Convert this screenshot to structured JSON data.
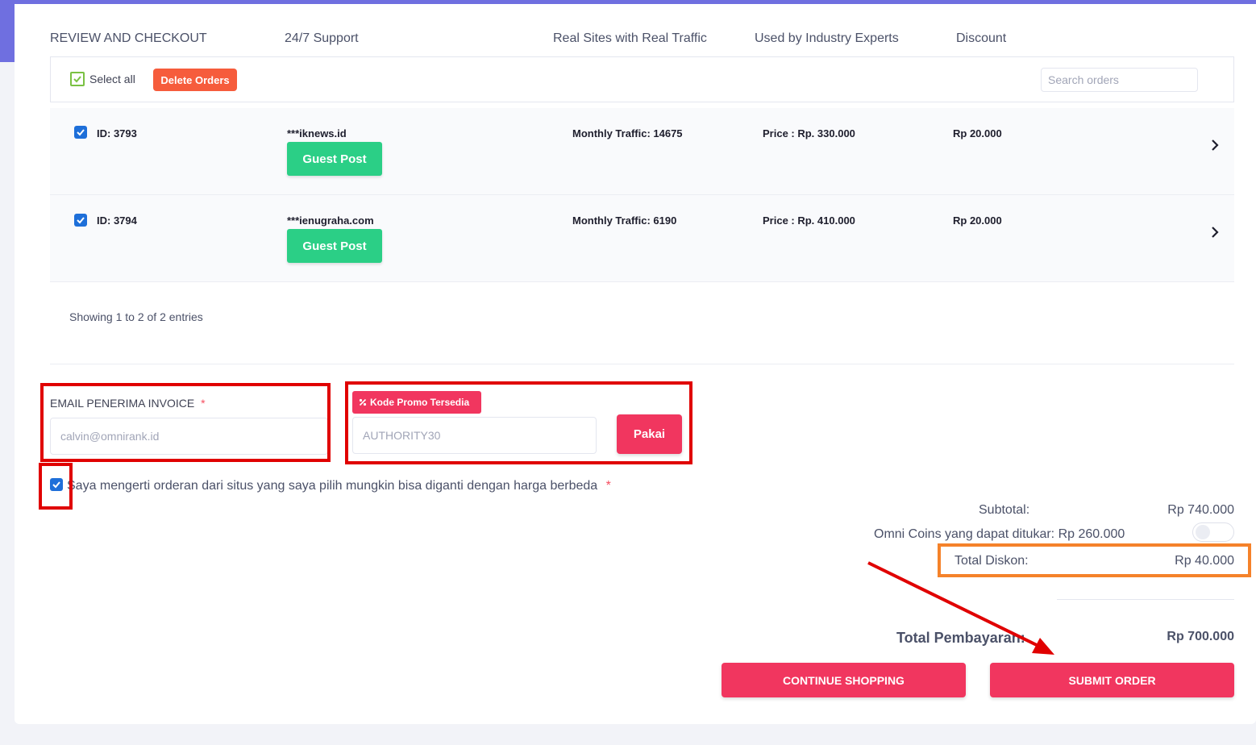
{
  "headers": {
    "review": "REVIEW AND CHECKOUT",
    "support": "24/7 Support",
    "traffic": "Real Sites with Real Traffic",
    "experts": "Used by Industry Experts",
    "discount": "Discount"
  },
  "toolbar": {
    "select_all": "Select all",
    "delete_orders": "Delete Orders",
    "search_placeholder": "Search orders"
  },
  "orders": [
    {
      "id": "ID: 3793",
      "site": "***iknews.id",
      "type": "Guest Post",
      "traffic": "Monthly Traffic: 14675",
      "price": "Price : Rp. 330.000",
      "discount": "Rp 20.000"
    },
    {
      "id": "ID: 3794",
      "site": "***ienugraha.com",
      "type": "Guest Post",
      "traffic": "Monthly Traffic: 6190",
      "price": "Price : Rp. 410.000",
      "discount": "Rp 20.000"
    }
  ],
  "pagination": {
    "info": "Showing 1 to 2 of 2 entries"
  },
  "invoice": {
    "label": "EMAIL PENERIMA INVOICE",
    "required_mark": "*",
    "email_value": "calvin@omnirank.id"
  },
  "promo": {
    "badge": "Kode Promo Tersedia",
    "code_value": "AUTHORITY30",
    "apply_label": "Pakai"
  },
  "agreement": {
    "text": "Saya mengerti orderan dari situs yang saya pilih mungkin bisa diganti dengan harga berbeda",
    "required_mark": "*"
  },
  "summary": {
    "subtotal_label": "Subtotal:",
    "subtotal_value": "Rp 740.000",
    "coins_label": "Omni Coins yang dapat ditukar: Rp 260.000",
    "total_discount_label": "Total Diskon:",
    "total_discount_value": "Rp 40.000",
    "total_payment_label": "Total Pembayaran:",
    "total_payment_value": "Rp 700.000"
  },
  "actions": {
    "continue_label": "CONTINUE SHOPPING",
    "submit_label": "SUBMIT ORDER"
  },
  "colors": {
    "accent_pink": "#f1365f",
    "green": "#2bcf86",
    "orange": "#f65c3c",
    "annotation_red": "#e00000",
    "annotation_orange": "#f5822a"
  }
}
